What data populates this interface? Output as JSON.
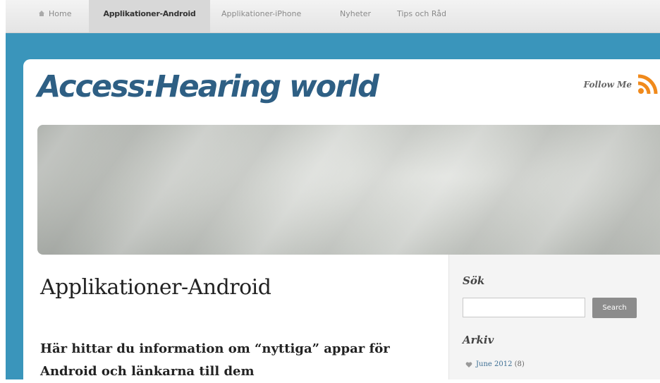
{
  "nav": {
    "items": [
      {
        "label": "Home",
        "icon": "home-icon",
        "active": false
      },
      {
        "label": "Applikationer-Android",
        "active": true
      },
      {
        "label": "Applikationer-iPhone",
        "active": false
      },
      {
        "label": "Nyheter",
        "active": false
      },
      {
        "label": "Tips och Råd",
        "active": false
      }
    ]
  },
  "header": {
    "site_title": "Access:Hearing world",
    "follow_label": "Follow Me",
    "rss_icon": "rss-icon"
  },
  "main": {
    "page_title": "Applikationer-Android",
    "intro": "Här hittar du information om “nyttiga” appar för Android och länkarna till dem"
  },
  "sidebar": {
    "search_heading": "Sök",
    "search_value": "",
    "search_button": "Search",
    "archive_heading": "Arkiv",
    "archive_items": [
      {
        "label": "June 2012",
        "count": "(8)"
      }
    ]
  },
  "colors": {
    "band": "#3a95bb",
    "title": "#2e5f84",
    "rss": "#f08a1c",
    "search_button": "#8c8c8c"
  }
}
